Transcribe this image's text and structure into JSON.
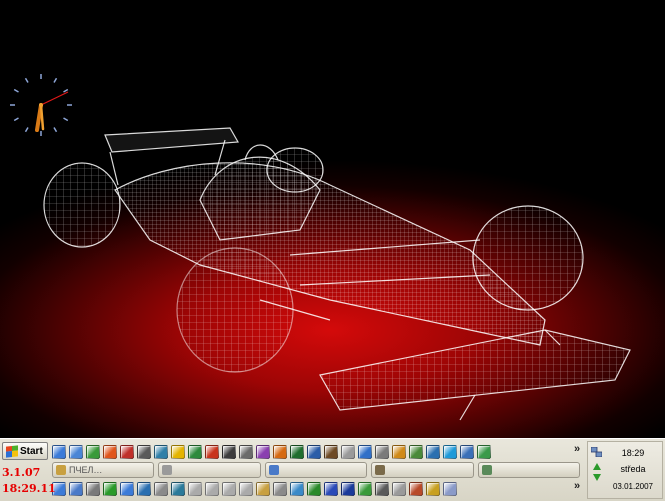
{
  "overlay": {
    "date": "3.1.07",
    "time": "18:29.11"
  },
  "taskbar": {
    "start_label": "Start",
    "quick_launch_top": [
      {
        "icon": "ie-icon",
        "color": "#3b7bd8"
      },
      {
        "icon": "document-icon",
        "color": "#4a86d6"
      },
      {
        "icon": "paint-icon",
        "color": "#3a9a3a"
      },
      {
        "icon": "firefox-icon",
        "color": "#e0561c"
      },
      {
        "icon": "target-icon",
        "color": "#c0302a"
      },
      {
        "icon": "chart-icon",
        "color": "#5a5a5a"
      },
      {
        "icon": "gear-icon",
        "color": "#2f7fa8"
      },
      {
        "icon": "star-icon",
        "color": "#e3b400"
      },
      {
        "icon": "spreadsheet-icon",
        "color": "#2d8a3d"
      },
      {
        "icon": "windows-icon",
        "color": "#c8341c"
      },
      {
        "icon": "calendar-icon",
        "color": "#3d3d3d"
      },
      {
        "icon": "transfer-icon",
        "color": "#6b6b6b"
      },
      {
        "icon": "settings-icon",
        "color": "#8a3fb0"
      },
      {
        "icon": "music-icon",
        "color": "#d66a12"
      },
      {
        "icon": "terminal-icon",
        "color": "#1f6e2e"
      },
      {
        "icon": "sync-icon",
        "color": "#2a5da8"
      },
      {
        "icon": "disk-icon",
        "color": "#6e4a24"
      },
      {
        "icon": "cd-icon",
        "color": "#9a9a9a"
      },
      {
        "icon": "help-icon",
        "color": "#3070c8"
      },
      {
        "icon": "tools-icon",
        "color": "#7a7a7a"
      },
      {
        "icon": "search-icon",
        "color": "#d08a18"
      },
      {
        "icon": "calculator-icon",
        "color": "#4a8a3a"
      },
      {
        "icon": "notes-icon",
        "color": "#2a6fb0"
      },
      {
        "icon": "skype-icon",
        "color": "#1e9ad8"
      },
      {
        "icon": "monitor-icon",
        "color": "#3a70b8"
      },
      {
        "icon": "picture-icon",
        "color": "#3a9a4a"
      }
    ],
    "quick_launch_bottom": [
      {
        "icon": "ie-icon",
        "color": "#3b7bd8"
      },
      {
        "icon": "computer-icon",
        "color": "#4a7ac8"
      },
      {
        "icon": "document-icon",
        "color": "#7a7a7a"
      },
      {
        "icon": "clock-icon",
        "color": "#2a9a2a"
      },
      {
        "icon": "ie-icon",
        "color": "#3b7bd8"
      },
      {
        "icon": "folder-icon",
        "color": "#2a6fb0"
      },
      {
        "icon": "audio-icon",
        "color": "#8a8a8a"
      },
      {
        "icon": "network-icon",
        "color": "#2a7a9a"
      },
      {
        "icon": "drive-icon",
        "color": "#aaaaaa"
      },
      {
        "icon": "drive-icon",
        "color": "#aaaaaa"
      },
      {
        "icon": "drive-icon",
        "color": "#aaaaaa"
      },
      {
        "icon": "drive-icon",
        "color": "#aaaaaa"
      },
      {
        "icon": "package-icon",
        "color": "#c8a040"
      },
      {
        "icon": "printer-icon",
        "color": "#8a8a8a"
      },
      {
        "icon": "user-icon",
        "color": "#3a8ac8"
      },
      {
        "icon": "flower-icon",
        "color": "#2a8a2a"
      },
      {
        "icon": "floppy-icon",
        "color": "#2a4ab8"
      },
      {
        "icon": "media-icon",
        "color": "#1a3a9a"
      },
      {
        "icon": "book-icon",
        "color": "#3a9a3a"
      },
      {
        "icon": "chip-icon",
        "color": "#5a5a5a"
      },
      {
        "icon": "drive-icon",
        "color": "#9a9a9a"
      },
      {
        "icon": "pen-icon",
        "color": "#b84a2a"
      },
      {
        "icon": "edit-icon",
        "color": "#c8a020"
      },
      {
        "icon": "battery-icon",
        "color": "#8a9ac8"
      }
    ],
    "chevron": "»",
    "tasks": [
      {
        "label": "ПЧЕЛ…",
        "icon_color": "#c8a040"
      },
      {
        "label": "",
        "icon_color": "#9a9a9a"
      },
      {
        "label": "",
        "icon_color": "#4a7ac8"
      },
      {
        "label": "",
        "icon_color": "#7a6a4a"
      },
      {
        "label": "",
        "icon_color": "#5a8a5a"
      }
    ]
  },
  "tray": {
    "time": "18:29",
    "day": "středa",
    "date": "03.01.2007"
  },
  "colors": {
    "overlay_text": "#e60000",
    "taskbar_bg": "#e2dfd2"
  }
}
